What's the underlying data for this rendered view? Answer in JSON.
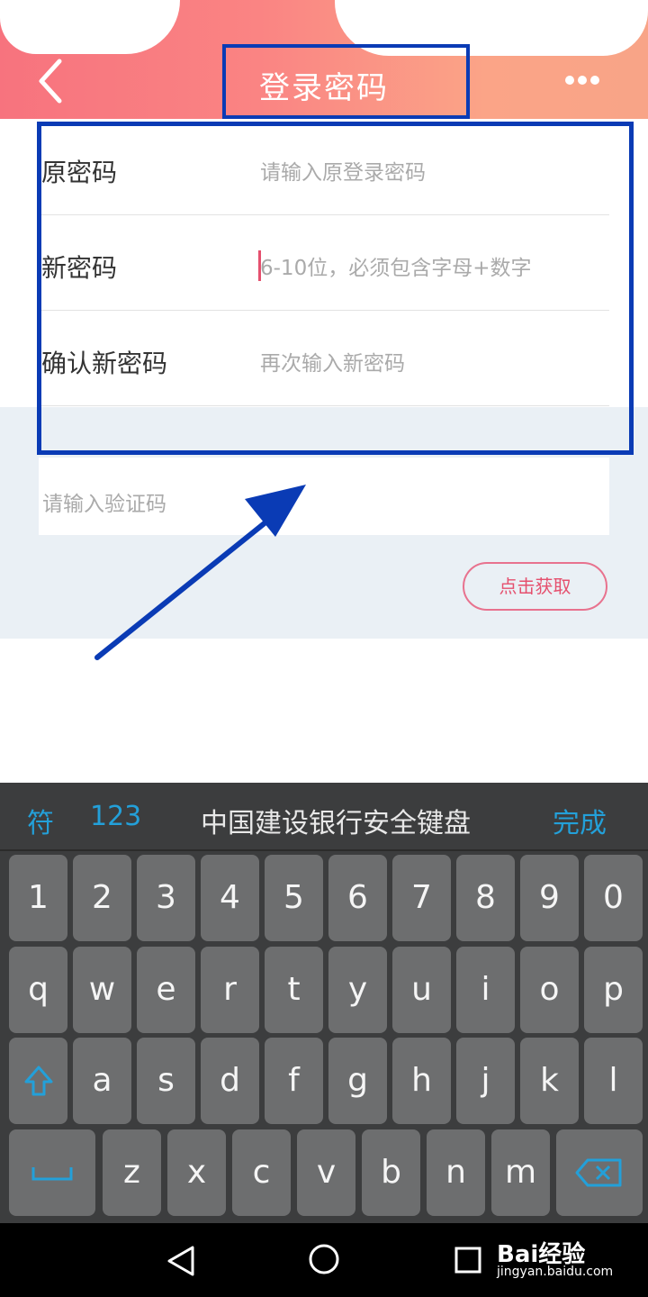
{
  "header": {
    "title": "登录密码"
  },
  "form": {
    "rows": [
      {
        "label": "原密码",
        "placeholder": "请输入原登录密码"
      },
      {
        "label": "新密码",
        "placeholder": "6-10位，必须包含字母+数字"
      },
      {
        "label": "确认新密码",
        "placeholder": "再次输入新密码"
      }
    ],
    "verify_placeholder": "请输入验证码",
    "get_code_label": "点击获取"
  },
  "keyboard": {
    "symbol_label": "符",
    "num_label": "123",
    "title": "中国建设银行安全键盘",
    "done_label": "完成",
    "rows": [
      [
        "1",
        "2",
        "3",
        "4",
        "5",
        "6",
        "7",
        "8",
        "9",
        "0"
      ],
      [
        "q",
        "w",
        "e",
        "r",
        "t",
        "y",
        "u",
        "i",
        "o",
        "p"
      ],
      [
        "a",
        "s",
        "d",
        "f",
        "g",
        "h",
        "j",
        "k",
        "l"
      ],
      [
        "z",
        "x",
        "c",
        "v",
        "b",
        "n",
        "m"
      ]
    ],
    "icon_shift": "shift-arrow-icon",
    "icon_space": "space-icon",
    "icon_delete": "backspace-icon"
  },
  "watermark": {
    "line1": "Bai经验",
    "line2": "jingyan.baidu.com"
  },
  "colors": {
    "accent": "#e5506e",
    "keyboard_accent": "#23a0d9",
    "annotation": "#0a3bb5"
  }
}
